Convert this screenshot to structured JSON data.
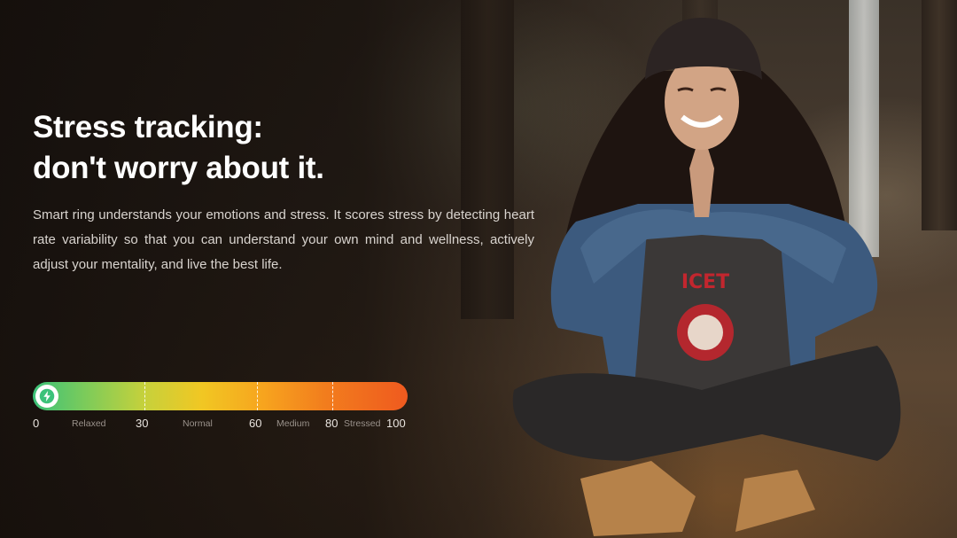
{
  "headline": {
    "line1": "Stress tracking:",
    "line2": "don't worry about it."
  },
  "description": "Smart ring understands your emotions and stress. It scores stress by detecting heart rate variability so that you can understand your own mind and wellness, actively adjust your mentality, and live the best life.",
  "stress_scale": {
    "icon": "lightning-icon",
    "colors": {
      "start": "#3cc27a",
      "middle": "#f1c723",
      "end": "#ef5a1f"
    },
    "min": "0",
    "max": "100",
    "thresholds": [
      "30",
      "60",
      "80"
    ],
    "zones": [
      "Relaxed",
      "Normal",
      "Medium",
      "Stressed"
    ]
  }
}
